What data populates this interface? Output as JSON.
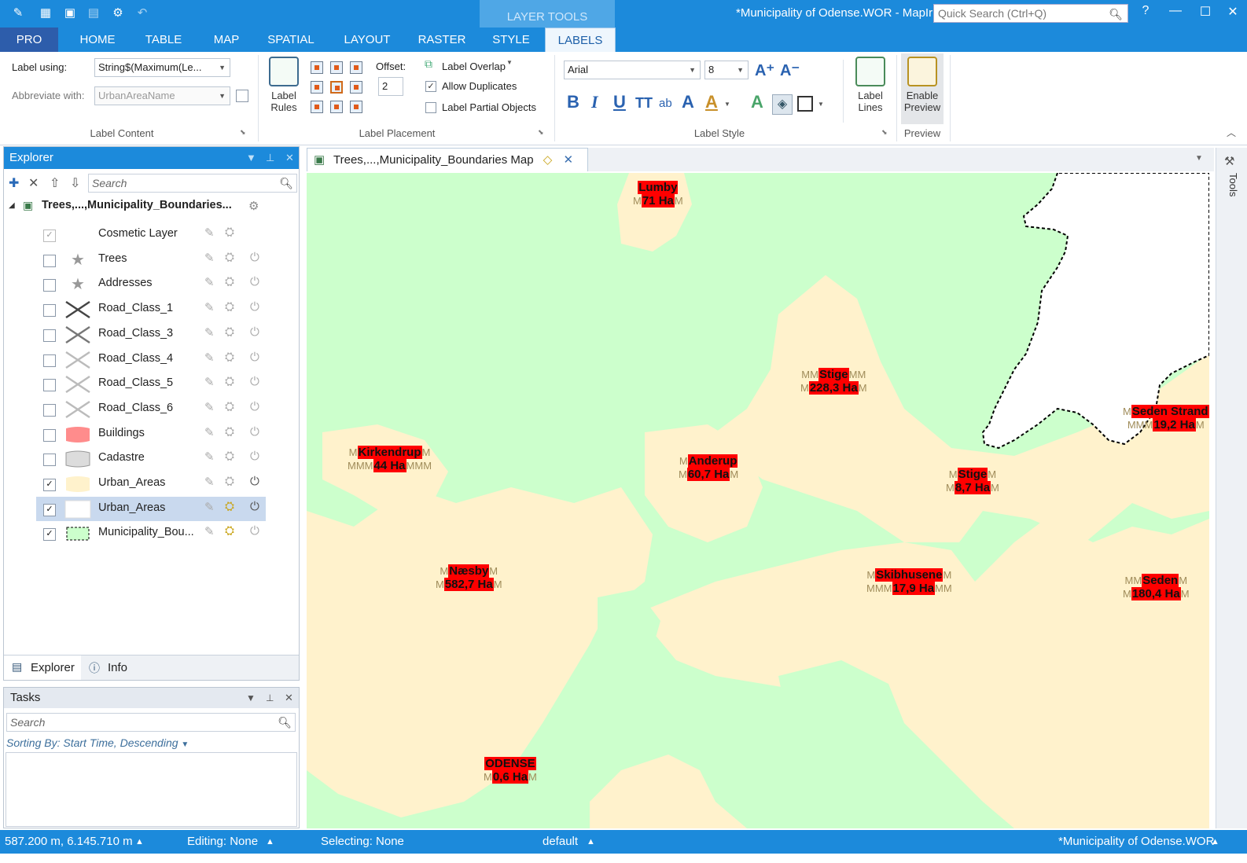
{
  "window": {
    "layer_tools": "LAYER TOOLS",
    "title": "*Municipality of Odense.WOR - MapIr",
    "quick_search_placeholder": "Quick Search (Ctrl+Q)"
  },
  "tabs": [
    "PRO",
    "HOME",
    "TABLE",
    "MAP",
    "SPATIAL",
    "LAYOUT",
    "RASTER",
    "STYLE",
    "LABELS"
  ],
  "active_tab": "LABELS",
  "ribbon": {
    "label_content": {
      "title": "Label Content",
      "label_using": "Label using:",
      "label_using_value": "String$(Maximum(Le...",
      "abbreviate_with": "Abbreviate with:",
      "abbreviate_value": "UrbanAreaName"
    },
    "label_placement": {
      "title": "Label Placement",
      "label_rules": "Label",
      "label_rules2": "Rules",
      "offset_label": "Offset:",
      "offset_value": "2",
      "label_overlap": "Label Overlap",
      "allow_duplicates": "Allow Duplicates",
      "allow_duplicates_checked": true,
      "label_partial": "Label Partial Objects",
      "label_partial_checked": false
    },
    "label_style": {
      "title": "Label Style",
      "font": "Arial",
      "size": "8",
      "label_lines": "Label",
      "label_lines2": "Lines"
    },
    "preview": {
      "title": "Preview",
      "enable": "Enable",
      "preview": "Preview"
    }
  },
  "explorer": {
    "title": "Explorer",
    "search_placeholder": "Search",
    "root": "Trees,...,Municipality_Boundaries...",
    "layers": [
      {
        "name": "Cosmetic Layer",
        "checked": true,
        "grey": true
      },
      {
        "name": "Trees",
        "checked": false
      },
      {
        "name": "Addresses",
        "checked": false
      },
      {
        "name": "Road_Class_1",
        "checked": false
      },
      {
        "name": "Road_Class_3",
        "checked": false
      },
      {
        "name": "Road_Class_4",
        "checked": false
      },
      {
        "name": "Road_Class_5",
        "checked": false
      },
      {
        "name": "Road_Class_6",
        "checked": false
      },
      {
        "name": "Buildings",
        "checked": false
      },
      {
        "name": "Cadastre",
        "checked": false
      },
      {
        "name": "Urban_Areas",
        "checked": true
      },
      {
        "name": "Urban_Areas",
        "checked": true,
        "selected": true
      },
      {
        "name": "Municipality_Bou...",
        "checked": true
      }
    ],
    "footer_tabs": [
      "Explorer",
      "Info"
    ]
  },
  "tasks": {
    "title": "Tasks",
    "search_placeholder": "Search",
    "sorting": "Sorting By: Start Time, Descending"
  },
  "map": {
    "tab_title": "Trees,...,Municipality_Boundaries Map",
    "labels": [
      {
        "name": "Lumby",
        "area": "71 Ha",
        "ghost_left": "",
        "ghost_right": "",
        "ghost2_left": "M",
        "ghost2_right": "M"
      },
      {
        "name": "Stige",
        "area": "228,3 Ha",
        "ghost_left": "MM",
        "ghost_right": "MM",
        "ghost2_left": "M",
        "ghost2_right": "M"
      },
      {
        "name": "Kirkendrup",
        "area": "44 Ha",
        "ghost_left": "M",
        "ghost_right": "M",
        "ghost2_left": "MMM",
        "ghost2_right": "MMM"
      },
      {
        "name": "Anderup",
        "area": "60,7 Ha",
        "ghost_left": "M",
        "ghost_right": "",
        "ghost2_left": "M",
        "ghost2_right": "M"
      },
      {
        "name": "Stige",
        "area": "8,7 Ha",
        "ghost_left": "M",
        "ghost_right": "M",
        "ghost2_left": "M",
        "ghost2_right": "M"
      },
      {
        "name": "Seden Strand",
        "area": "19,2 Ha",
        "ghost_left": "M",
        "ghost_right": "",
        "ghost2_left": "MMM",
        "ghost2_right": "M"
      },
      {
        "name": "Næsby",
        "area": "582,7 Ha",
        "ghost_left": "M",
        "ghost_right": "M",
        "ghost2_left": "M",
        "ghost2_right": "M"
      },
      {
        "name": "Skibhusene",
        "area": "17,9 Ha",
        "ghost_left": "M",
        "ghost_right": "M",
        "ghost2_left": "MMM",
        "ghost2_right": "MM"
      },
      {
        "name": "Seden",
        "area": "180,4 Ha",
        "ghost_left": "MM",
        "ghost_right": "M",
        "ghost2_left": "M",
        "ghost2_right": "M"
      },
      {
        "name": "ODENSE",
        "area": "0,6 Ha",
        "ghost_left": "",
        "ghost_right": "",
        "ghost2_left": "M",
        "ghost2_right": "M"
      }
    ]
  },
  "toolbar_right": "Tools",
  "status": {
    "coords": "587.200 m, 6.145.710 m",
    "editing": "Editing: None",
    "selecting": "Selecting: None",
    "style": "default",
    "workspace": "*Municipality of Odense.WOR"
  },
  "colors": {
    "accent": "#1c8adb",
    "urban": "#fff2cc",
    "land": "#ccffcc",
    "label_bg": "#ff0000"
  }
}
